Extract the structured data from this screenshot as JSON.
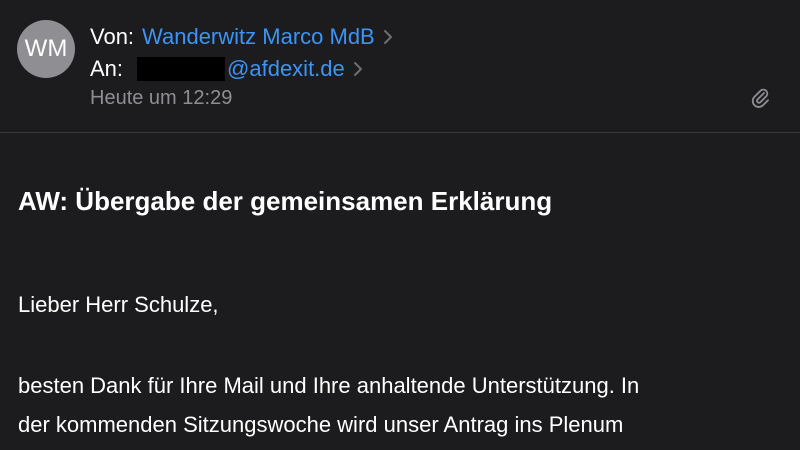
{
  "header": {
    "avatar_initials": "WM",
    "from_label": "Von:",
    "sender_name": "Wanderwitz Marco MdB",
    "to_label": "An:",
    "recipient_domain": "@afdexit.de",
    "date": "Heute um 12:29",
    "icons": {
      "chevron": "chevron-right-icon",
      "attachment": "paperclip-icon"
    }
  },
  "message": {
    "subject": "AW: Übergabe der gemeinsamen Erklärung",
    "greeting": "Lieber Herr Schulze,",
    "body_lines": [
      "besten Dank für Ihre Mail und Ihre anhaltende Unterstützung. In",
      "der kommenden Sitzungswoche wird unser Antrag ins Plenum"
    ]
  },
  "colors": {
    "background": "#1c1c1e",
    "accent_link": "#3c94f5",
    "secondary_text": "#8e8e93",
    "avatar_bg": "#8e8e93"
  }
}
